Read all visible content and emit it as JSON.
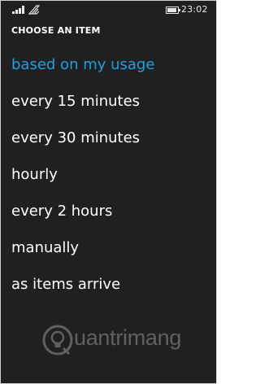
{
  "status_bar": {
    "signal_icon": "signal-strength-icon",
    "wifi_icon": "wifi-icon",
    "battery_icon": "battery-icon",
    "battery_level": 0.9,
    "time": "23:02"
  },
  "picker": {
    "header": "CHOOSE AN ITEM",
    "accent_color": "#1ba1e2",
    "selected_index": 0,
    "items": [
      {
        "label": "based on my usage"
      },
      {
        "label": "every 15 minutes"
      },
      {
        "label": "every 30 minutes"
      },
      {
        "label": "hourly"
      },
      {
        "label": "every 2 hours"
      },
      {
        "label": "manually"
      },
      {
        "label": "as items arrive"
      }
    ]
  },
  "watermark": {
    "icon": "lightbulb-icon",
    "text": "uantrimang"
  }
}
